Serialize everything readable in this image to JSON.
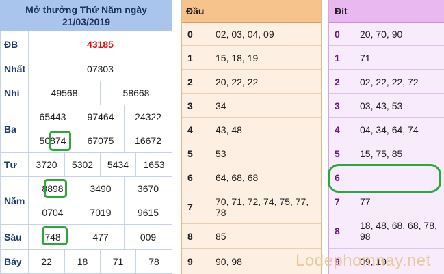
{
  "result": {
    "title_line1": "Mở thưởng Thứ Năm ngày",
    "title_line2": "21/03/2019",
    "rows": [
      {
        "label": "ĐB",
        "values": [
          "43185"
        ]
      },
      {
        "label": "Nhất",
        "values": [
          "07303"
        ]
      },
      {
        "label": "Nhì",
        "values": [
          "49568",
          "58668"
        ]
      },
      {
        "label": "Ba",
        "values": [
          "65443",
          "97464",
          "24322",
          "50874",
          "67075",
          "16672"
        ]
      },
      {
        "label": "Tư",
        "values": [
          "3720",
          "5302",
          "5434",
          "1653"
        ]
      },
      {
        "label": "Năm",
        "values": [
          "8898",
          "3490",
          "3670",
          "0704",
          "7019",
          "9615"
        ]
      },
      {
        "label": "Sáu",
        "values": [
          "748",
          "477",
          "009"
        ]
      },
      {
        "label": "Bảy",
        "values": [
          "22",
          "18",
          "71",
          "78"
        ]
      }
    ],
    "special_color": "#e01010"
  },
  "dau": {
    "header": "Đầu",
    "rows": [
      {
        "num": "0",
        "vals": "02, 03, 04, 09"
      },
      {
        "num": "1",
        "vals": "15, 18, 19"
      },
      {
        "num": "2",
        "vals": "20, 22, 22"
      },
      {
        "num": "3",
        "vals": "34"
      },
      {
        "num": "4",
        "vals": "43, 48"
      },
      {
        "num": "5",
        "vals": "53"
      },
      {
        "num": "6",
        "vals": "64, 68, 68"
      },
      {
        "num": "7",
        "vals": "70, 71, 72, 74, 75, 77, 78"
      },
      {
        "num": "8",
        "vals": "85"
      },
      {
        "num": "9",
        "vals": "90, 98"
      }
    ]
  },
  "dit": {
    "header": "Đít",
    "rows": [
      {
        "num": "0",
        "vals": "20, 70, 90"
      },
      {
        "num": "1",
        "vals": "71"
      },
      {
        "num": "2",
        "vals": "02, 22, 22, 72"
      },
      {
        "num": "3",
        "vals": "03, 43, 53"
      },
      {
        "num": "4",
        "vals": "04, 34, 64, 74"
      },
      {
        "num": "5",
        "vals": "15, 75, 85"
      },
      {
        "num": "6",
        "vals": ""
      },
      {
        "num": "7",
        "vals": "77"
      },
      {
        "num": "8",
        "vals": "18, 48, 68, 68, 78, 98"
      },
      {
        "num": "9",
        "vals": "09, 19"
      }
    ]
  },
  "watermark": "Lodephomnay.net",
  "colors": {
    "blue_header": "#a9c5ec",
    "orange_header": "#f6c38c",
    "orange_row": "#fdf0e2",
    "purple_header": "#e9b8f0",
    "purple_row": "#f8ebfb",
    "highlight": "#2aa83a"
  }
}
